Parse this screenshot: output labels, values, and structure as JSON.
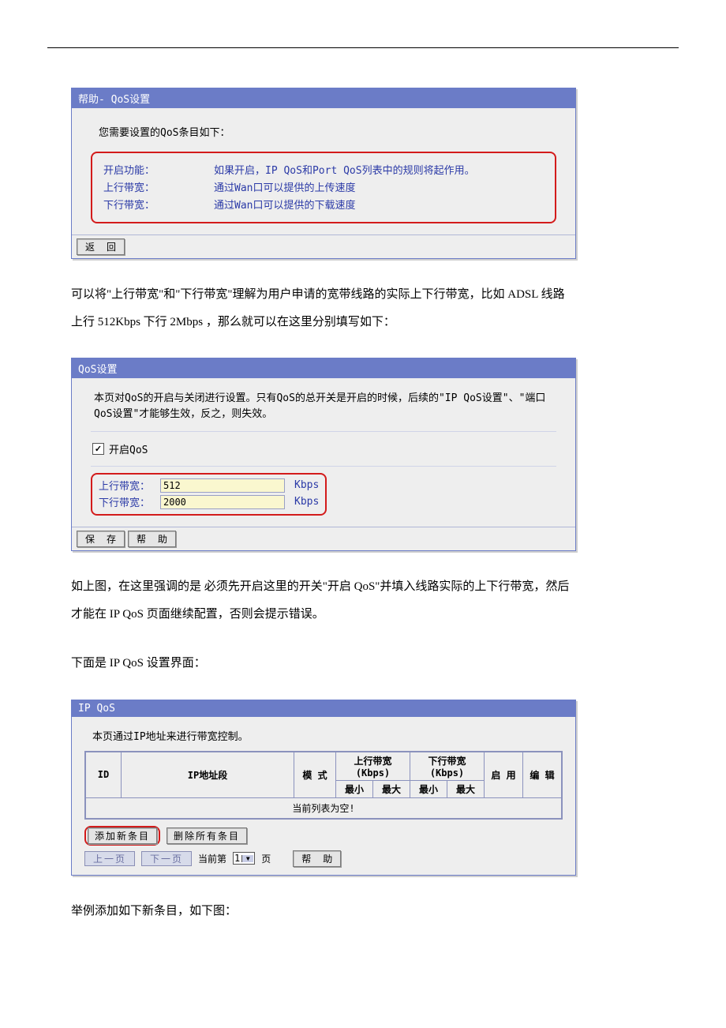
{
  "help_panel": {
    "title": "帮助- QoS设置",
    "intro": "您需要设置的QoS条目如下：",
    "rows": [
      {
        "label": "开启功能：",
        "value": "如果开启，IP QoS和Port QoS列表中的规则将起作用。"
      },
      {
        "label": "上行带宽：",
        "value": "通过Wan口可以提供的上传速度"
      },
      {
        "label": "下行带宽：",
        "value": "通过Wan口可以提供的下载速度"
      }
    ],
    "back_label": "返 回"
  },
  "para1": "可以将\"上行带宽\"和\"下行带宽\"理解为用户申请的宽带线路的实际上下行带宽，比如 ADSL 线路上行 512Kbps 下行 2Mbps ，那么就可以在这里分别填写如下：",
  "qos_panel": {
    "title": "QoS设置",
    "desc": "本页对QoS的开启与关闭进行设置。只有QoS的总开关是开启的时候，后续的\"IP QoS设置\"、\"端口QoS设置\"才能够生效，反之，则失效。",
    "checkbox_label": "开启QoS",
    "checkbox_checked": true,
    "uplink_label": "上行带宽：",
    "uplink_value": "512",
    "downlink_label": "下行带宽：",
    "downlink_value": "2000",
    "unit": "Kbps",
    "save_label": "保 存",
    "help_label": "帮 助"
  },
  "para2": "如上图，在这里强调的是 必须先开启这里的开关\"开启 QoS\"并填入线路实际的上下行带宽，然后才能在 IP QoS 页面继续配置，否则会提示错误。",
  "para3": "下面是 IP QoS 设置界面：",
  "ipqos_panel": {
    "title": "IP QoS",
    "desc": "本页通过IP地址来进行带宽控制。",
    "headers": {
      "id": "ID",
      "ip_range": "IP地址段",
      "mode": "模 式",
      "up_group": "上行带宽(Kbps)",
      "down_group": "下行带宽(Kbps)",
      "min": "最小",
      "max": "最大",
      "enable": "启 用",
      "edit": "编 辑"
    },
    "empty_text": "当前列表为空!",
    "add_label": "添加新条目",
    "del_all_label": "删除所有条目",
    "prev_label": "上一页",
    "next_label": "下一页",
    "cur_prefix": "当前第",
    "cur_page": "1",
    "cur_suffix": "页",
    "help_label": "帮 助"
  },
  "para4": "举例添加如下新条目，如下图："
}
